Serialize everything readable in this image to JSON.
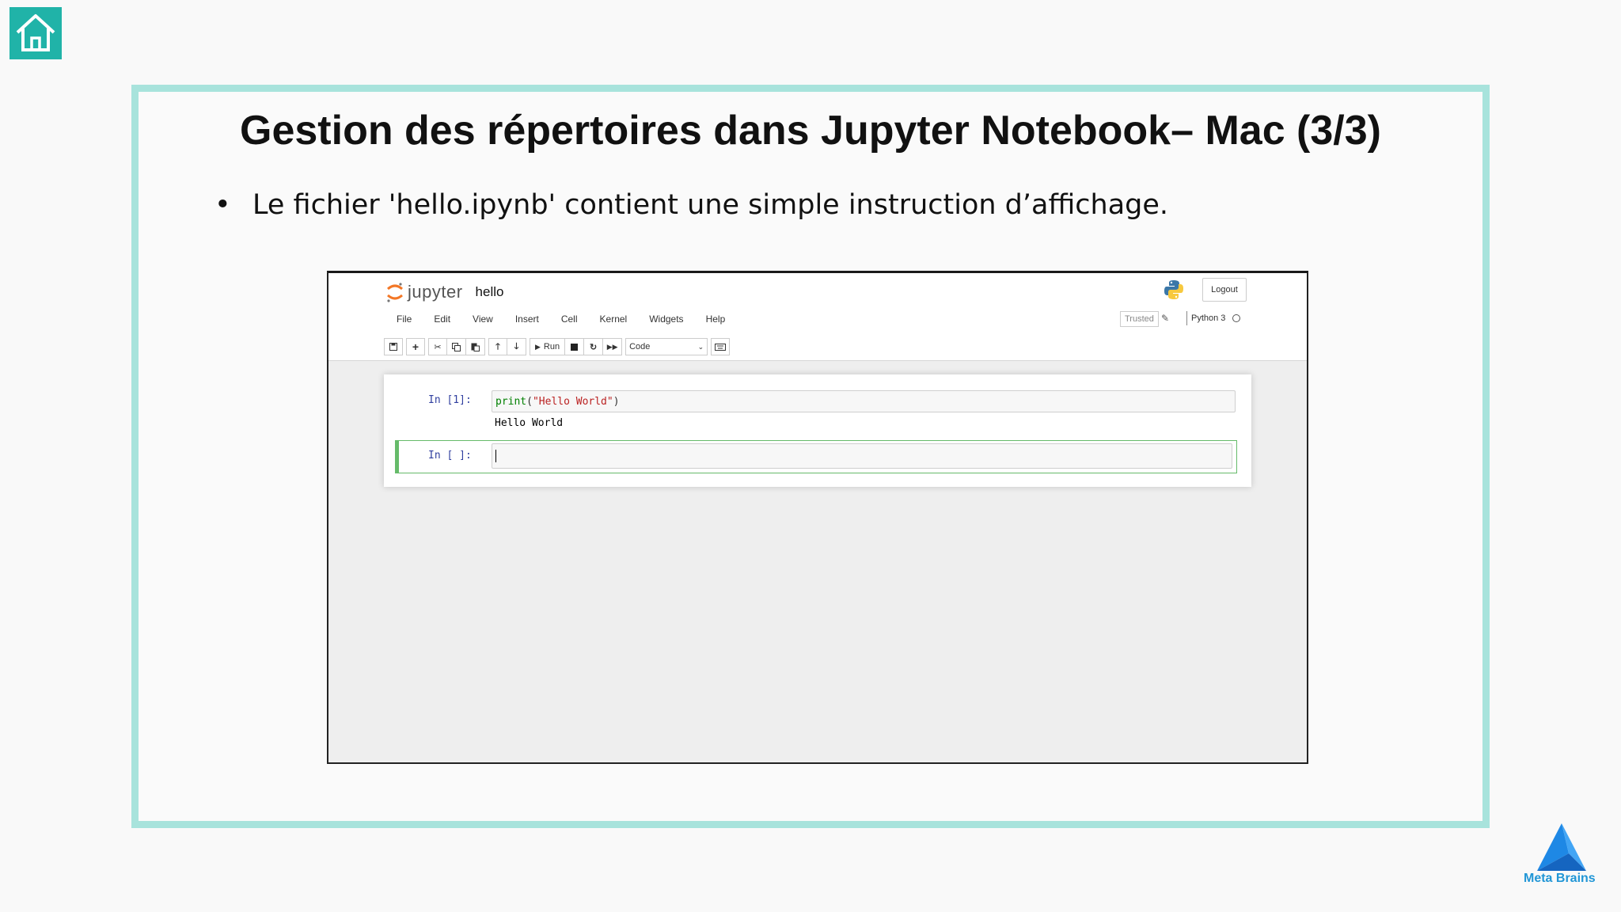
{
  "slide": {
    "title": "Gestion des répertoires dans Jupyter Notebook– Mac (3/3)",
    "bullet_mark": "•",
    "bullet_text": "Le fichier 'hello.ipynb' contient une simple instruction d’affichage.",
    "brand_name": "Meta Brains"
  },
  "jupyter": {
    "logo_text": "jupyter",
    "notebook_name": "hello",
    "logout_label": "Logout",
    "menu": [
      "File",
      "Edit",
      "View",
      "Insert",
      "Cell",
      "Kernel",
      "Widgets",
      "Help"
    ],
    "trusted_label": "Trusted",
    "kernel_name": "Python 3",
    "toolbar": {
      "run_label": "Run",
      "cell_type": "Code"
    },
    "cells": [
      {
        "prompt": "In [1]:",
        "code": {
          "func": "print",
          "open": "(",
          "arg": "\"Hello World\"",
          "close": ")"
        },
        "output": "Hello World"
      },
      {
        "prompt": "In [ ]:",
        "code": ""
      }
    ]
  },
  "colors": {
    "accent_teal": "#20b3a8",
    "frame_border": "#a8e3dc",
    "brand_blue": "#2196d6",
    "selected_cell_green": "#66bb6a"
  },
  "icons": {
    "home": "home-icon",
    "brand": "meta-brains-logo-icon",
    "jupyter": "jupyter-logo-icon",
    "python": "python-logo-icon"
  }
}
